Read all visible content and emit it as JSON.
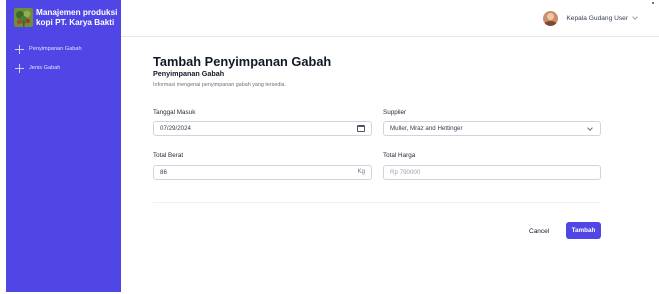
{
  "sidebar": {
    "brand_title": "Manajemen produksi kopi PT. Karya Bakti",
    "items": [
      {
        "label": "Penyimpanan Gabah",
        "icon": "plus-icon"
      },
      {
        "label": "Jenis Gabah",
        "icon": "plus-icon"
      }
    ]
  },
  "header": {
    "user_name": "Kepala Gudang User",
    "icon": "chevron-down-icon"
  },
  "form": {
    "title": "Tambah Penyimpanan Gabah",
    "section_title": "Penyimpanan Gabah",
    "section_description": "Informasi mengenai penyimpanan gabah yang tersedia.",
    "tanggal_masuk": {
      "label": "Tanggal Masuk",
      "value": "07/29/2024",
      "icon": "calendar-icon"
    },
    "supplier": {
      "label": "Supplier",
      "value": "Muller, Mraz and Hettinger",
      "icon": "chevron-down-icon"
    },
    "total_berat": {
      "label": "Total Berat",
      "value": "86",
      "suffix": "Kg"
    },
    "total_harga": {
      "label": "Total Harga",
      "placeholder": "Rp 790000"
    },
    "cancel_label": "Cancel",
    "submit_label": "Tambah"
  },
  "colors": {
    "accent": "#4f46e5",
    "sidebar_bg": "#4f46e5",
    "background": "#ffffff"
  }
}
